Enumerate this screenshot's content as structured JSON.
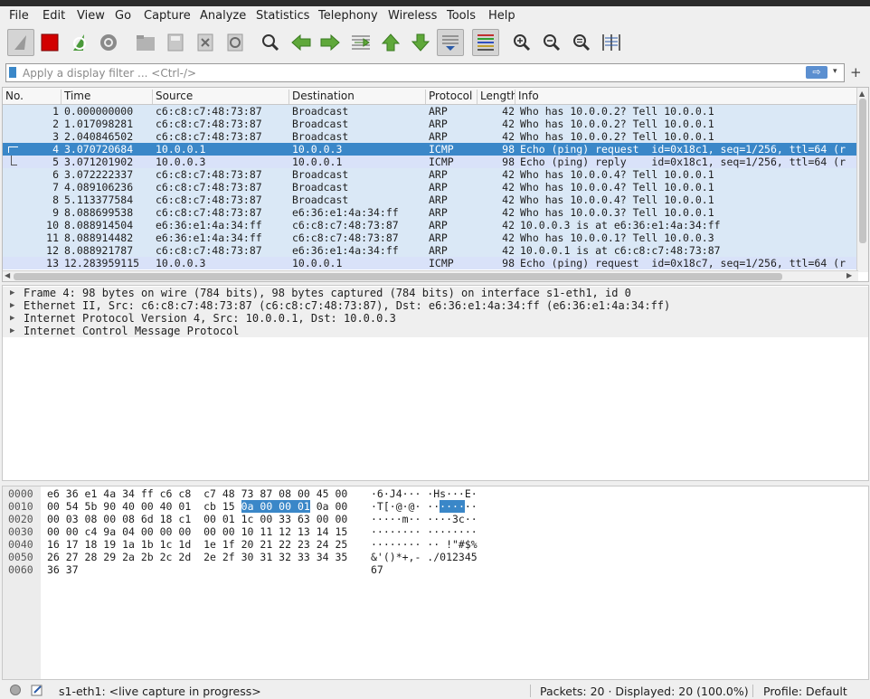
{
  "menu": [
    "File",
    "Edit",
    "View",
    "Go",
    "Capture",
    "Analyze",
    "Statistics",
    "Telephony",
    "Wireless",
    "Tools",
    "Help"
  ],
  "toolbar_icons": [
    "shark-fin-start-icon",
    "stop-capture-icon",
    "restart-capture-icon",
    "capture-options-icon",
    "open-file-icon",
    "save-file-icon",
    "close-file-icon",
    "reload-file-icon",
    "find-packet-icon",
    "go-back-icon",
    "go-forward-icon",
    "go-to-packet-icon",
    "go-first-packet-icon",
    "go-last-packet-icon",
    "auto-scroll-icon",
    "colorize-icon",
    "zoom-in-icon",
    "zoom-out-icon",
    "zoom-normal-icon",
    "resize-columns-icon"
  ],
  "filter": {
    "placeholder": "Apply a display filter ... <Ctrl-/>",
    "apply_label": "⇨",
    "add_label": "+"
  },
  "columns": [
    "No.",
    "Time",
    "Source",
    "Destination",
    "Protocol",
    "Length",
    "Info"
  ],
  "packets": [
    {
      "no": "1",
      "time": "0.000000000",
      "src": "c6:c8:c7:48:73:87",
      "dst": "Broadcast",
      "proto": "ARP",
      "len": "42",
      "info": "Who has 10.0.0.2? Tell 10.0.0.1",
      "cls": "arp"
    },
    {
      "no": "2",
      "time": "1.017098281",
      "src": "c6:c8:c7:48:73:87",
      "dst": "Broadcast",
      "proto": "ARP",
      "len": "42",
      "info": "Who has 10.0.0.2? Tell 10.0.0.1",
      "cls": "arp"
    },
    {
      "no": "3",
      "time": "2.040846502",
      "src": "c6:c8:c7:48:73:87",
      "dst": "Broadcast",
      "proto": "ARP",
      "len": "42",
      "info": "Who has 10.0.0.2? Tell 10.0.0.1",
      "cls": "arp"
    },
    {
      "no": "4",
      "time": "3.070720684",
      "src": "10.0.0.1",
      "dst": "10.0.0.3",
      "proto": "ICMP",
      "len": "98",
      "info": "Echo (ping) request  id=0x18c1, seq=1/256, ttl=64 (r",
      "cls": "sel"
    },
    {
      "no": "5",
      "time": "3.071201902",
      "src": "10.0.0.3",
      "dst": "10.0.0.1",
      "proto": "ICMP",
      "len": "98",
      "info": "Echo (ping) reply    id=0x18c1, seq=1/256, ttl=64 (r",
      "cls": "icmp"
    },
    {
      "no": "6",
      "time": "3.072222337",
      "src": "c6:c8:c7:48:73:87",
      "dst": "Broadcast",
      "proto": "ARP",
      "len": "42",
      "info": "Who has 10.0.0.4? Tell 10.0.0.1",
      "cls": "arp"
    },
    {
      "no": "7",
      "time": "4.089106236",
      "src": "c6:c8:c7:48:73:87",
      "dst": "Broadcast",
      "proto": "ARP",
      "len": "42",
      "info": "Who has 10.0.0.4? Tell 10.0.0.1",
      "cls": "arp"
    },
    {
      "no": "8",
      "time": "5.113377584",
      "src": "c6:c8:c7:48:73:87",
      "dst": "Broadcast",
      "proto": "ARP",
      "len": "42",
      "info": "Who has 10.0.0.4? Tell 10.0.0.1",
      "cls": "arp"
    },
    {
      "no": "9",
      "time": "8.088699538",
      "src": "c6:c8:c7:48:73:87",
      "dst": "e6:36:e1:4a:34:ff",
      "proto": "ARP",
      "len": "42",
      "info": "Who has 10.0.0.3? Tell 10.0.0.1",
      "cls": "arp"
    },
    {
      "no": "10",
      "time": "8.088914504",
      "src": "e6:36:e1:4a:34:ff",
      "dst": "c6:c8:c7:48:73:87",
      "proto": "ARP",
      "len": "42",
      "info": "10.0.0.3 is at e6:36:e1:4a:34:ff",
      "cls": "arp"
    },
    {
      "no": "11",
      "time": "8.088914482",
      "src": "e6:36:e1:4a:34:ff",
      "dst": "c6:c8:c7:48:73:87",
      "proto": "ARP",
      "len": "42",
      "info": "Who has 10.0.0.1? Tell 10.0.0.3",
      "cls": "arp"
    },
    {
      "no": "12",
      "time": "8.088921787",
      "src": "c6:c8:c7:48:73:87",
      "dst": "e6:36:e1:4a:34:ff",
      "proto": "ARP",
      "len": "42",
      "info": "10.0.0.1 is at c6:c8:c7:48:73:87",
      "cls": "arp"
    },
    {
      "no": "13",
      "time": "12.283959115",
      "src": "10.0.0.3",
      "dst": "10.0.0.1",
      "proto": "ICMP",
      "len": "98",
      "info": "Echo (ping) request  id=0x18c7, seq=1/256, ttl=64 (r",
      "cls": "icmp"
    }
  ],
  "details": [
    "Frame 4: 98 bytes on wire (784 bits), 98 bytes captured (784 bits) on interface s1-eth1, id 0",
    "Ethernet II, Src: c6:c8:c7:48:73:87 (c6:c8:c7:48:73:87), Dst: e6:36:e1:4a:34:ff (e6:36:e1:4a:34:ff)",
    "Internet Protocol Version 4, Src: 10.0.0.1, Dst: 10.0.0.3",
    "Internet Control Message Protocol"
  ],
  "bytes": [
    {
      "off": "0000",
      "hex": "e6 36 e1 4a 34 ff c6 c8  c7 48 73 87 08 00 45 00",
      "hexpre": "",
      "hexhl": "",
      "hexpost": "",
      "asc": "·6·J4··· ·Hs···E·",
      "ascpre": "",
      "aschl": "",
      "ascpost": ""
    },
    {
      "off": "0010",
      "hex": "",
      "hexpre": "00 54 5b 90 40 00 40 01  cb 15 ",
      "hexhl": "0a 00 00 01",
      "hexpost": " 0a 00",
      "asc": "",
      "ascpre": "·T[·@·@· ··",
      "aschl": "····",
      "ascpost": "··"
    },
    {
      "off": "0020",
      "hex": "00 03 08 00 08 6d 18 c1  00 01 1c 00 33 63 00 00",
      "hexpre": "",
      "hexhl": "",
      "hexpost": "",
      "asc": "·····m·· ····3c··",
      "ascpre": "",
      "aschl": "",
      "ascpost": ""
    },
    {
      "off": "0030",
      "hex": "00 00 c4 9a 04 00 00 00  00 00 10 11 12 13 14 15",
      "hexpre": "",
      "hexhl": "",
      "hexpost": "",
      "asc": "········ ········",
      "ascpre": "",
      "aschl": "",
      "ascpost": ""
    },
    {
      "off": "0040",
      "hex": "16 17 18 19 1a 1b 1c 1d  1e 1f 20 21 22 23 24 25",
      "hexpre": "",
      "hexhl": "",
      "hexpost": "",
      "asc": "········ ·· !\"#$%",
      "ascpre": "",
      "aschl": "",
      "ascpost": ""
    },
    {
      "off": "0050",
      "hex": "26 27 28 29 2a 2b 2c 2d  2e 2f 30 31 32 33 34 35",
      "hexpre": "",
      "hexhl": "",
      "hexpost": "",
      "asc": "&'()*+,- ./012345",
      "ascpre": "",
      "aschl": "",
      "ascpost": ""
    },
    {
      "off": "0060",
      "hex": "36 37",
      "hexpre": "",
      "hexhl": "",
      "hexpost": "",
      "asc": "67",
      "ascpre": "",
      "aschl": "",
      "ascpost": ""
    }
  ],
  "status": {
    "interface": "s1-eth1: <live capture in progress>",
    "packets": "Packets: 20 · Displayed: 20 (100.0%)",
    "profile": "Profile: Default"
  }
}
